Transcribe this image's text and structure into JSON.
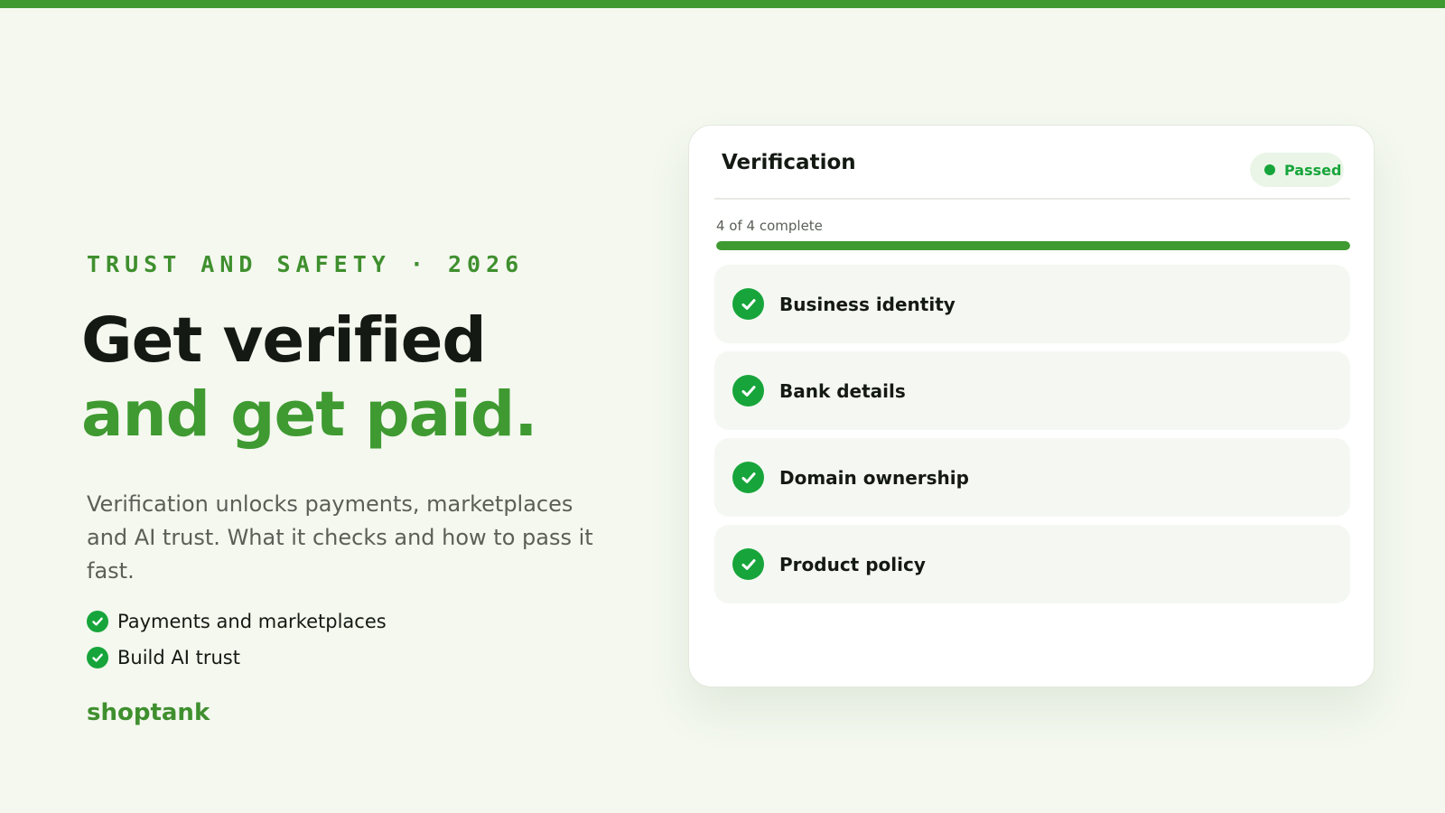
{
  "eyebrow": "TRUST AND SAFETY · 2026",
  "headline": {
    "line1": "Get verified",
    "line2": "and get paid."
  },
  "description": "Verification unlocks payments, marketplaces and AI trust. What it checks and how to pass it fast.",
  "bullets": [
    {
      "label": "Payments and marketplaces",
      "icon": "check-circle-icon"
    },
    {
      "label": "Build AI trust",
      "icon": "check-circle-icon"
    }
  ],
  "brand": "shoptank",
  "card": {
    "title": "Verification",
    "status": {
      "label": "Passed",
      "color": "#17a53b"
    },
    "progress": {
      "label": "4 of 4 complete",
      "completed": 4,
      "total": 4,
      "fraction": 1.0
    },
    "steps": [
      {
        "label": "Business identity",
        "status": "complete",
        "icon": "check-circle-icon"
      },
      {
        "label": "Bank details",
        "status": "complete",
        "icon": "check-circle-icon"
      },
      {
        "label": "Domain ownership",
        "status": "complete",
        "icon": "check-circle-icon"
      },
      {
        "label": "Product policy",
        "status": "complete",
        "icon": "check-circle-icon"
      }
    ]
  },
  "colors": {
    "accent": "#3f9a31",
    "success": "#17a53b",
    "background": "#f4f8ef",
    "text_dark": "#141a13",
    "text_muted": "#5a5f57"
  }
}
